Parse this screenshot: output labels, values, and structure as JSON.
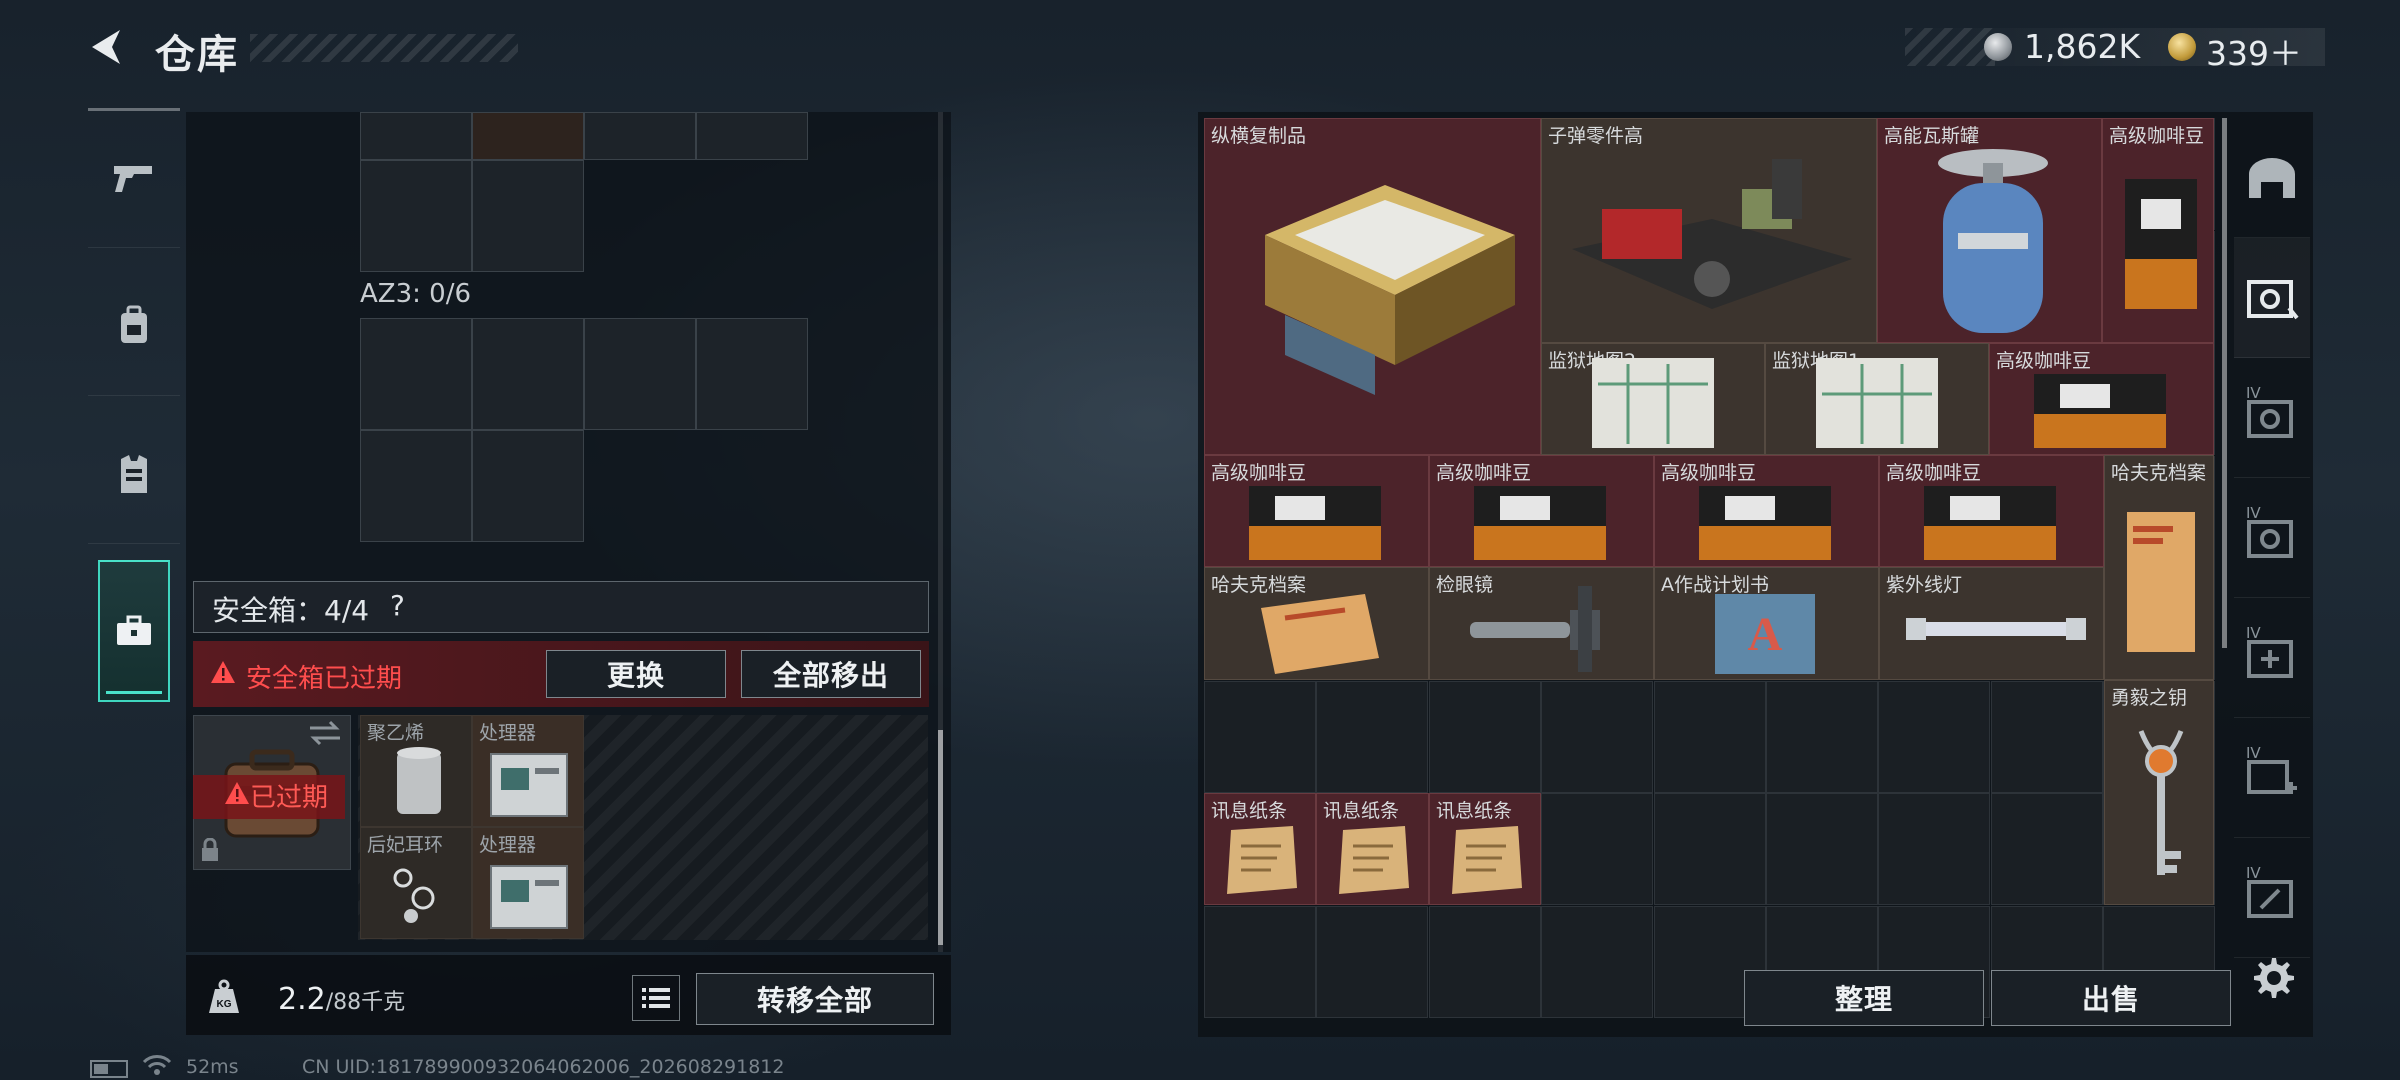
{
  "header": {
    "title": "仓库",
    "currency_silver": "1,862K",
    "currency_gold": "339＋"
  },
  "left_nav": {
    "items": [
      "weapon-icon",
      "backpack-icon",
      "vest-icon",
      "safebox-icon"
    ],
    "active": "safebox-icon"
  },
  "left_panel": {
    "az3_label": "AZ3: 0/6",
    "safebox_label": "安全箱：4/4",
    "help": "?",
    "expired_notice": "安全箱已过期",
    "replace_button": "更换",
    "move_all_out_button": "全部移出",
    "safe_item_badge": "已过期",
    "items": [
      {
        "name": "聚乙烯"
      },
      {
        "name": "处理器"
      },
      {
        "name": "后妃耳环"
      },
      {
        "name": "处理器"
      }
    ]
  },
  "bottom_bar": {
    "weight": "2.2",
    "capacity": "/88千克",
    "transfer_all_button": "转移全部",
    "kg_icon_text": "KG"
  },
  "status": {
    "ping": "52ms",
    "uid": "CN UID:181789900932064062006_202608291812"
  },
  "stash": {
    "items": [
      {
        "name": "纵横复制品",
        "color": "red"
      },
      {
        "name": "子弹零件高",
        "color": "brown"
      },
      {
        "name": "高能瓦斯罐",
        "color": "red"
      },
      {
        "name": "高级咖啡豆",
        "color": "red"
      },
      {
        "name": "监狱地图2",
        "color": "brown"
      },
      {
        "name": "监狱地图1",
        "color": "brown"
      },
      {
        "name": "高级咖啡豆",
        "color": "red"
      },
      {
        "name": "高级咖啡豆",
        "color": "red"
      },
      {
        "name": "高级咖啡豆",
        "color": "red"
      },
      {
        "name": "高级咖啡豆",
        "color": "red"
      },
      {
        "name": "高级咖啡豆",
        "color": "red"
      },
      {
        "name": "哈夫克档案",
        "color": "brown"
      },
      {
        "name": "哈夫克档案",
        "color": "brown"
      },
      {
        "name": "检眼镜",
        "color": "brown"
      },
      {
        "name": "A作战计划书",
        "color": "brown"
      },
      {
        "name": "紫外线灯",
        "color": "brown"
      },
      {
        "name": "勇毅之钥",
        "color": "brown"
      },
      {
        "name": "讯息纸条",
        "color": "red"
      },
      {
        "name": "讯息纸条",
        "color": "red"
      },
      {
        "name": "讯息纸条",
        "color": "red"
      }
    ],
    "sort_button": "整理",
    "sell_button": "出售"
  },
  "right_nav": {
    "items": [
      "helmet-icon",
      "armory-icon",
      "armory-iv-icon",
      "armory-iv-icon",
      "armory-iv-icon",
      "armory-iv-add-icon",
      "armory-iv-icon"
    ],
    "labels": [
      "IV",
      "IV",
      "IV",
      "IV",
      "IV"
    ]
  },
  "colors": {
    "accent": "#49e2c9",
    "warning": "#ff4d4d",
    "item_red": "#4c232a",
    "item_brown": "#3c342e"
  }
}
